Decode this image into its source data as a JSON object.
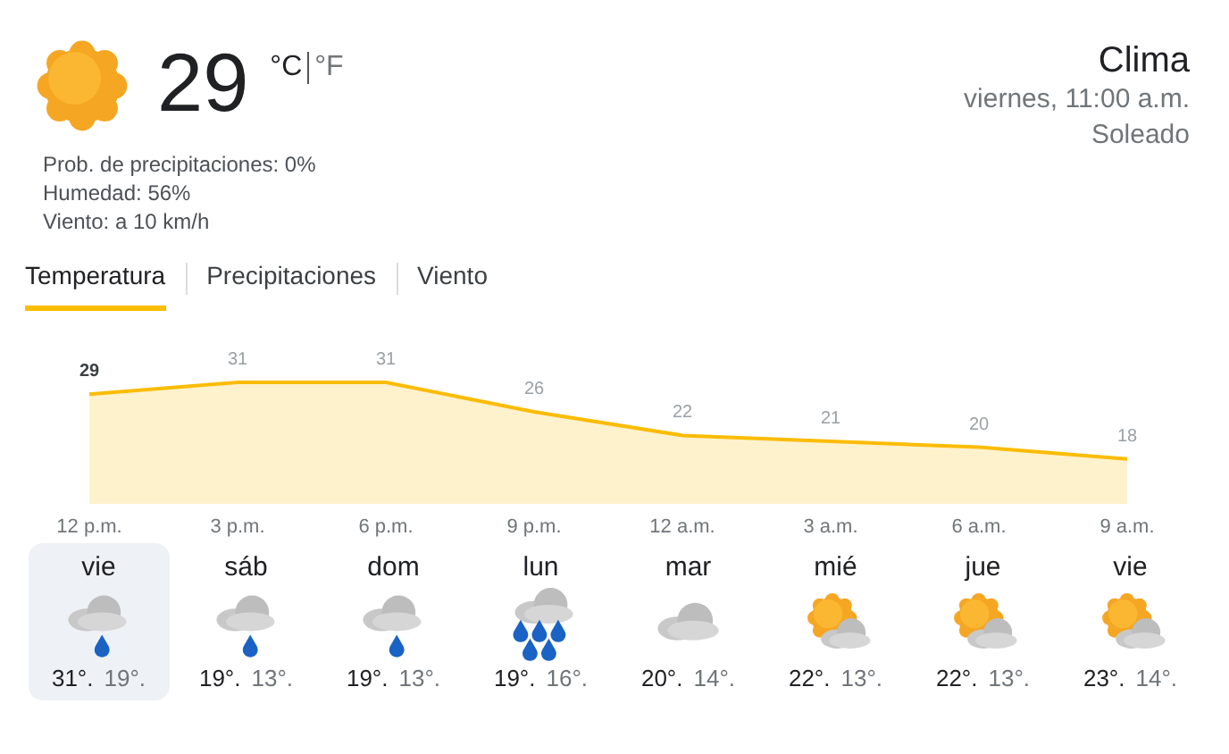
{
  "current": {
    "kind": "sunny",
    "temperature": "29",
    "units": [
      {
        "label": "°C",
        "selected": true
      },
      {
        "label": "°F",
        "selected": false
      }
    ],
    "details": [
      "Prob. de precipitaciones: 0%",
      "Humedad: 56%",
      "Viento: a 10 km/h"
    ]
  },
  "header": {
    "title": "Clima",
    "time": "viernes, 11:00 a.m.",
    "condition": "Soleado"
  },
  "tabs": [
    {
      "label": "Temperatura",
      "selected": true
    },
    {
      "label": "Precipitaciones",
      "selected": false
    },
    {
      "label": "Viento",
      "selected": false
    }
  ],
  "chart_data": {
    "type": "area",
    "categories": [
      "12 p.m.",
      "3 p.m.",
      "6 p.m.",
      "9 p.m.",
      "12 a.m.",
      "3 a.m.",
      "6 a.m.",
      "9 a.m."
    ],
    "series": [
      {
        "color": "#fbbc04",
        "values": [
          29,
          31,
          31,
          26,
          22,
          21,
          20,
          18
        ]
      }
    ],
    "data_labels": true
  },
  "days": [
    {
      "day": "vie",
      "kind": "rain",
      "high": "31°.",
      "low": "19°.",
      "selected": true
    },
    {
      "day": "sáb",
      "kind": "rain",
      "high": "19°.",
      "low": "13°.",
      "selected": false
    },
    {
      "day": "dom",
      "kind": "rain",
      "high": "19°.",
      "low": "13°.",
      "selected": false
    },
    {
      "day": "lun",
      "kind": "heavy-rain",
      "high": "19°.",
      "low": "16°.",
      "selected": false
    },
    {
      "day": "mar",
      "kind": "cloudy",
      "high": "20°.",
      "low": "14°.",
      "selected": false
    },
    {
      "day": "mié",
      "kind": "partly-sunny",
      "high": "22°.",
      "low": "13°.",
      "selected": false
    },
    {
      "day": "jue",
      "kind": "partly-sunny",
      "high": "22°.",
      "low": "13°.",
      "selected": false
    },
    {
      "day": "vie",
      "kind": "partly-sunny",
      "high": "23°.",
      "low": "14°.",
      "selected": false
    }
  ]
}
